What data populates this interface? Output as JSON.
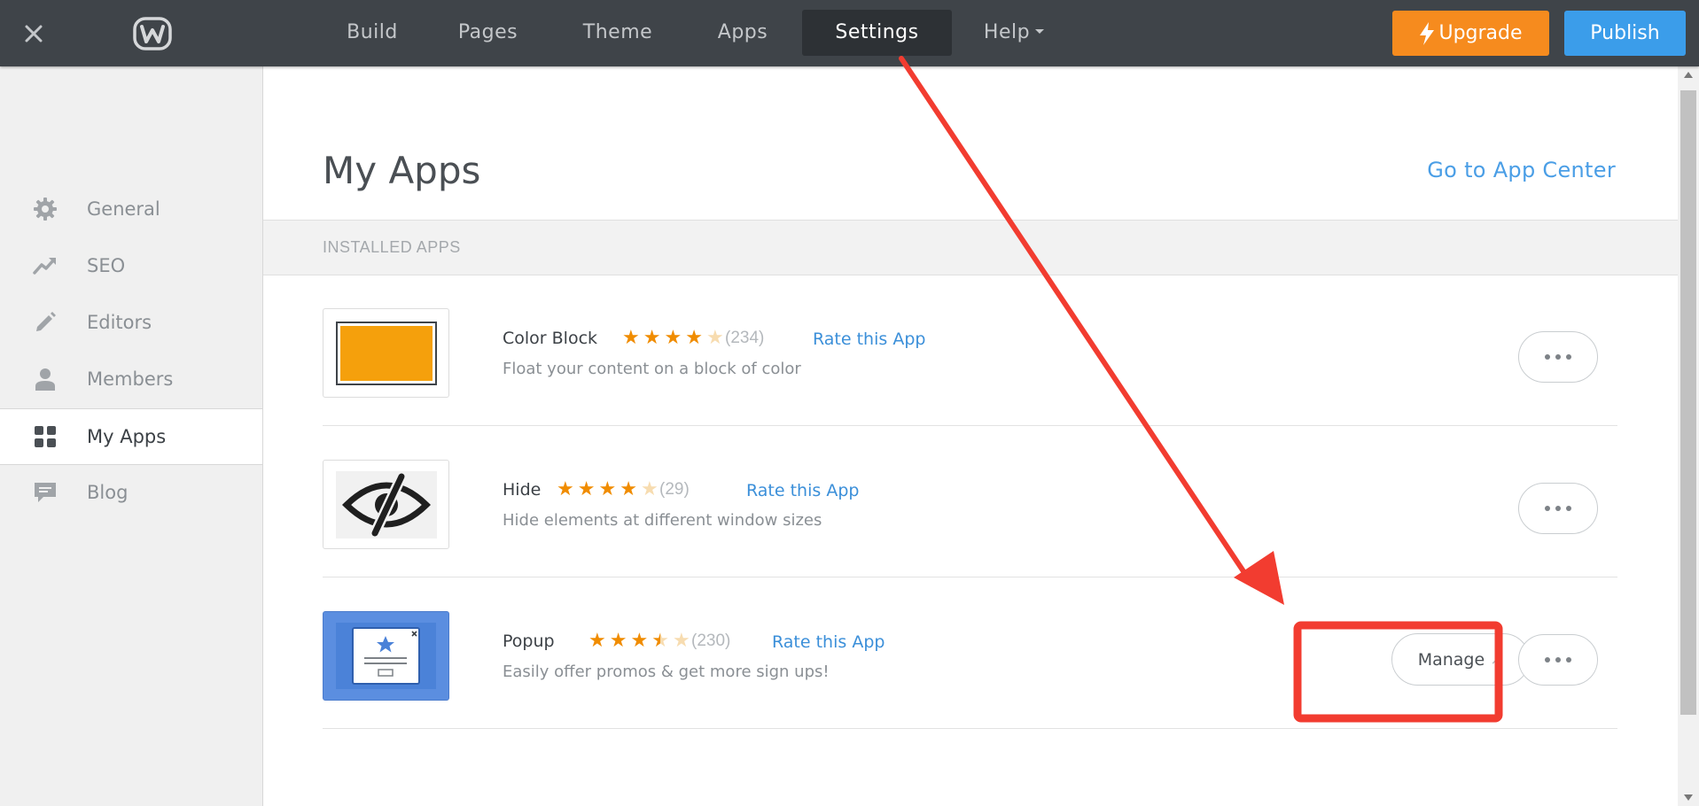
{
  "topbar": {
    "nav": [
      {
        "label": "Build"
      },
      {
        "label": "Pages"
      },
      {
        "label": "Theme"
      },
      {
        "label": "Apps"
      },
      {
        "label": "Settings",
        "active": true
      },
      {
        "label": "Help"
      }
    ],
    "upgrade_label": "Upgrade",
    "publish_label": "Publish",
    "colors": {
      "bar": "#3f4449",
      "upgrade": "#f68b1e",
      "publish": "#3b9dea"
    }
  },
  "sidebar": {
    "items": [
      {
        "label": "General",
        "icon": "gear-icon"
      },
      {
        "label": "SEO",
        "icon": "trend-icon"
      },
      {
        "label": "Editors",
        "icon": "pencil-icon"
      },
      {
        "label": "Members",
        "icon": "person-icon"
      },
      {
        "label": "My Apps",
        "icon": "apps-grid-icon",
        "active": true
      },
      {
        "label": "Blog",
        "icon": "comment-icon"
      }
    ]
  },
  "main": {
    "title": "My Apps",
    "app_center_link": "Go to App Center",
    "section_label": "INSTALLED APPS",
    "apps": [
      {
        "name": "Color Block",
        "rating": 4,
        "count": "(234)",
        "rate_link": "Rate this App",
        "description": "Float your content on a block of color",
        "icon": "color-block-thumbnail"
      },
      {
        "name": "Hide",
        "rating": 4,
        "count": "(29)",
        "rate_link": "Rate this App",
        "description": "Hide elements at different window sizes",
        "icon": "hide-eye-thumbnail"
      },
      {
        "name": "Popup",
        "rating": 3.5,
        "count": "(230)",
        "rate_link": "Rate this App",
        "description": "Easily offer promos & get more sign ups!",
        "icon": "popup-thumbnail",
        "manage_label": "Manage"
      }
    ]
  },
  "annotation": {
    "color": "#f23c30"
  }
}
